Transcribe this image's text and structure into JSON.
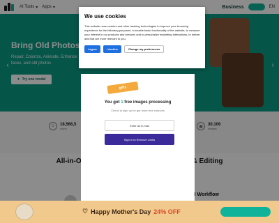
{
  "colors": {
    "brand": "#0fb39a",
    "hero_bg": "#0c9c86",
    "cookie_button": "#1e6fe0",
    "promo_bg": "#f2c98c",
    "signin_button": "#3b2b9a"
  },
  "navbar": {
    "links": [
      "AI Tools",
      "Apps"
    ],
    "pricing": "Business",
    "lang": "EN"
  },
  "hero": {
    "title": "Bring Old Photos S",
    "description": "Repair, Colorize, Animate, Enhance faces, and old photos",
    "button_label": "Try one model"
  },
  "stats": [
    {
      "icon": "users-icon",
      "value": "18,566,5",
      "label": "users"
    },
    {
      "icon": "image-icon",
      "value": "30,106",
      "label": "images"
    }
  ],
  "section_title": "All-in-One AI Image Tools for Generation & Editing",
  "workflow_title": "Build Your Own AI Workflow",
  "login": {
    "banner": "gifts",
    "title_prefix": "You got ",
    "title_highlight": "1",
    "title_suffix": " free images processing",
    "subtitle": "Check to sign up for get more free chances",
    "email_button": "Enter an E-mail",
    "signin_button": "Sign in to Remove Limits"
  },
  "promo": {
    "text": "Happy Mother's Day",
    "offer": "24% OFF"
  },
  "cookie": {
    "title": "We use cookies",
    "body": "This website uses cookies and other tracking technologies to improve your browsing experience for the following purposes: to enable basic functionality of the website, to measure your interest in our products and services and to personalize marketing interactions, to deliver ads that are more relevant to you.",
    "agree_label": "I agree",
    "decline_label": "I decline",
    "prefs_label": "Change my preferences"
  }
}
